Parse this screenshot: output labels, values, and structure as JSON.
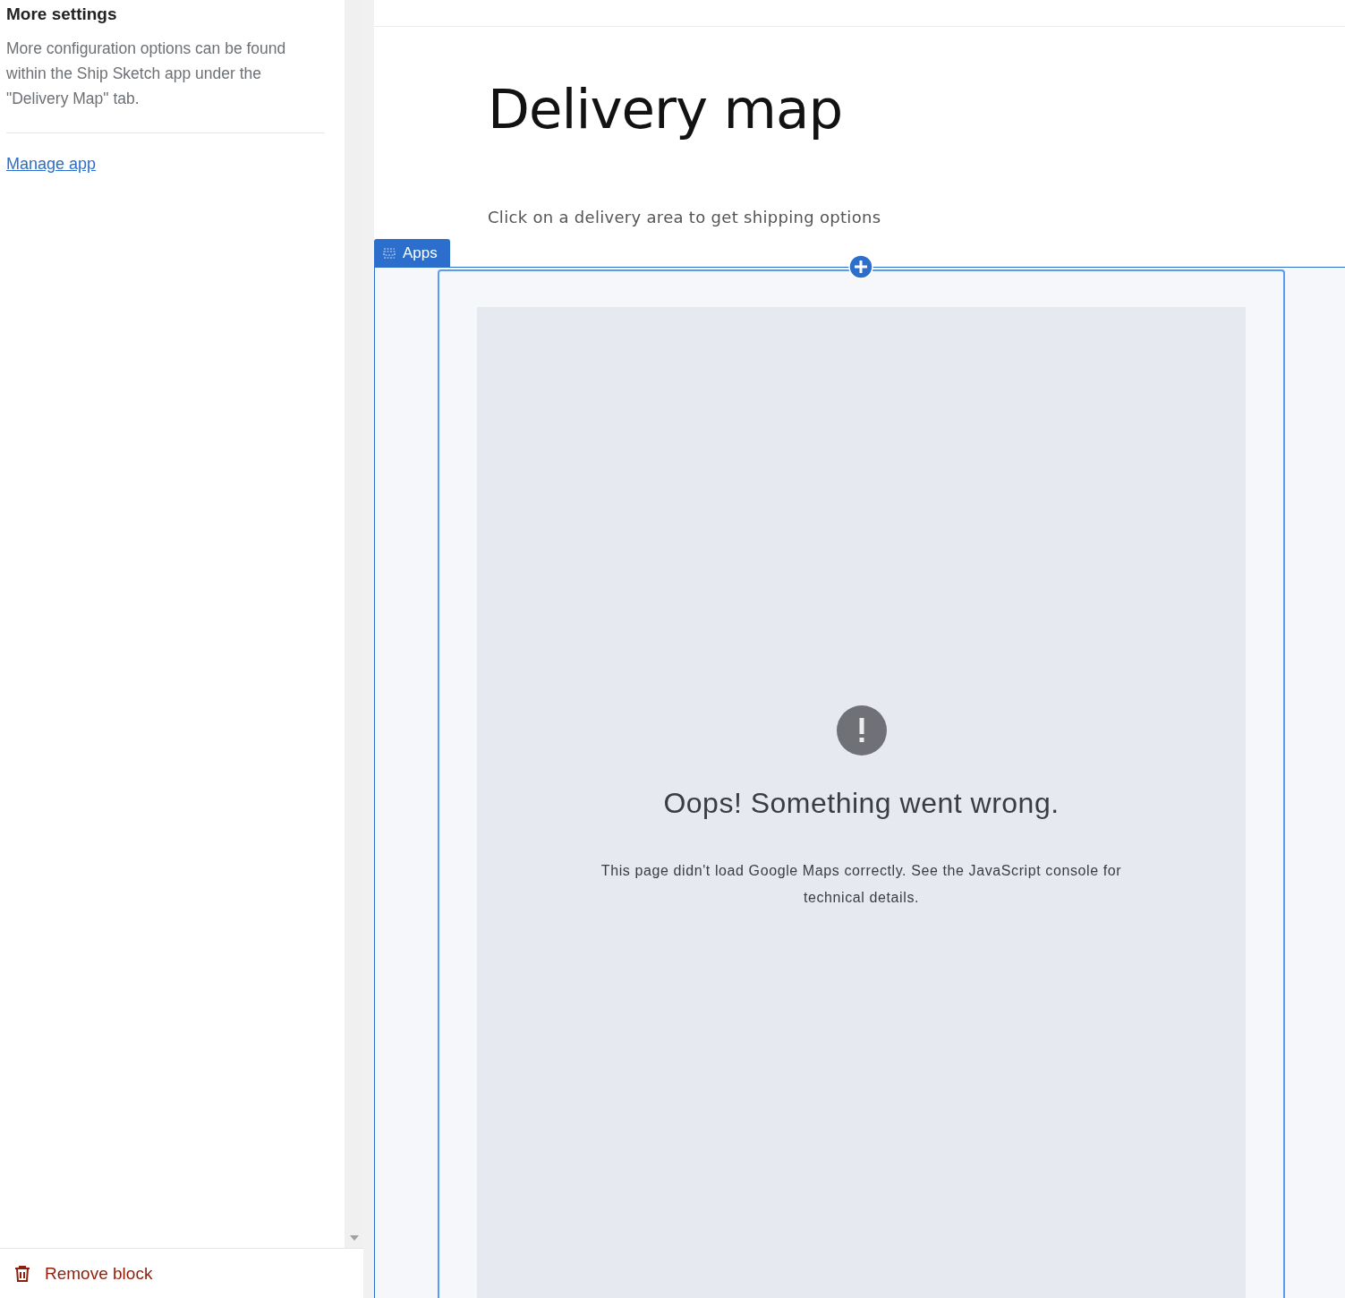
{
  "sidebar": {
    "section_title": "More settings",
    "description": "More configuration options can be found within the Ship Sketch app under the \"Delivery Map\" tab.",
    "link": "Manage app",
    "footer_action": "Remove block"
  },
  "page": {
    "title": "Delivery map",
    "subtitle": "Click on a delivery area to get shipping options",
    "block_tab": "Apps",
    "map_error": {
      "heading": "Oops! Something went wrong.",
      "message": "This page didn't load Google Maps correctly. See the JavaScript console for technical details."
    }
  }
}
